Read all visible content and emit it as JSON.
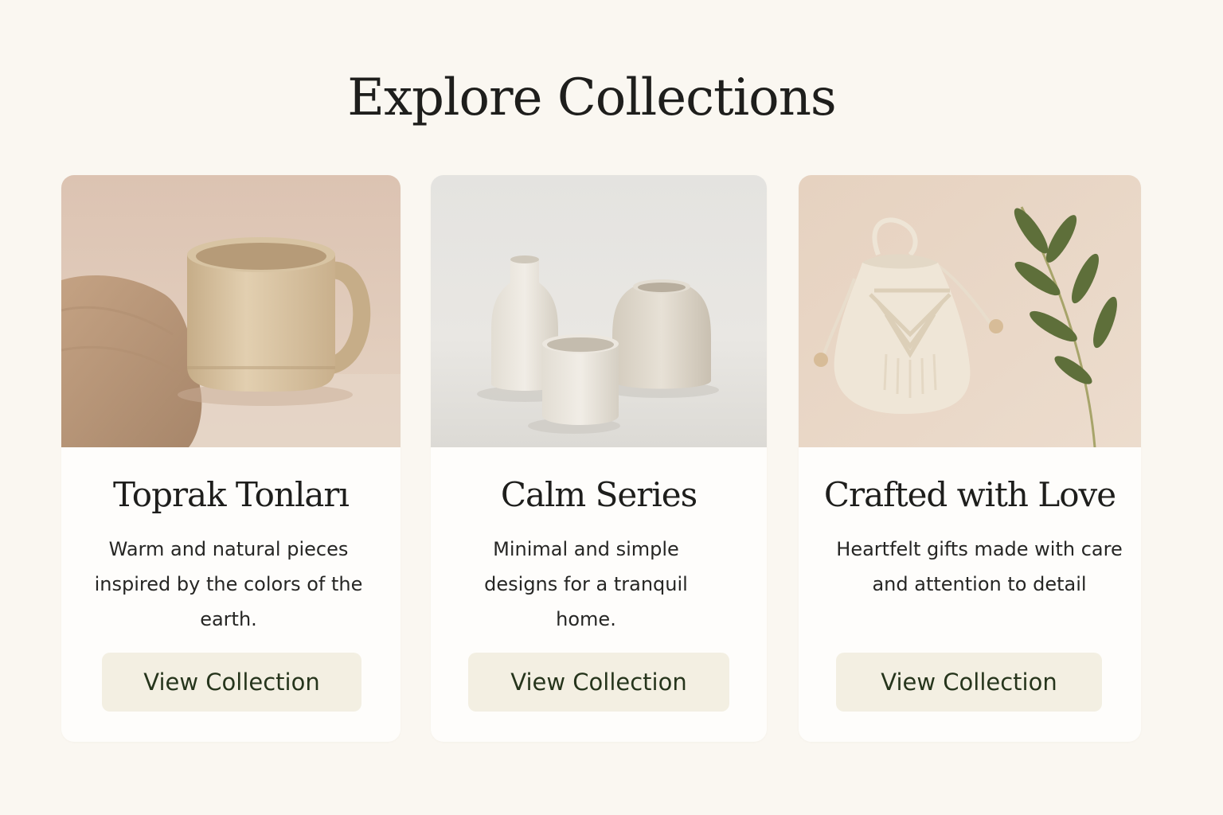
{
  "page": {
    "title": "Explore Collections"
  },
  "colors": {
    "background": "#faf7f1",
    "card": "#fefdfb",
    "button_bg": "#f3efe2",
    "button_text": "#26351c"
  },
  "collections": [
    {
      "title": "Toprak Tonları",
      "description": "Warm and natural pieces inspired by the colors of the earth.",
      "button_label": "View Collection",
      "image_subject": "beige-ceramic-mug-with-linen-cloth"
    },
    {
      "title": "Calm Series",
      "description": "Minimal and simple designs for a tranquil home.",
      "button_label": "View Collection",
      "image_subject": "white-ceramic-vases-and-cup"
    },
    {
      "title": "Crafted with Love",
      "description": "Heartfelt gifts made with care and attention to detail",
      "button_label": "View Collection",
      "image_subject": "macrame-pouch-with-olive-branch"
    }
  ]
}
